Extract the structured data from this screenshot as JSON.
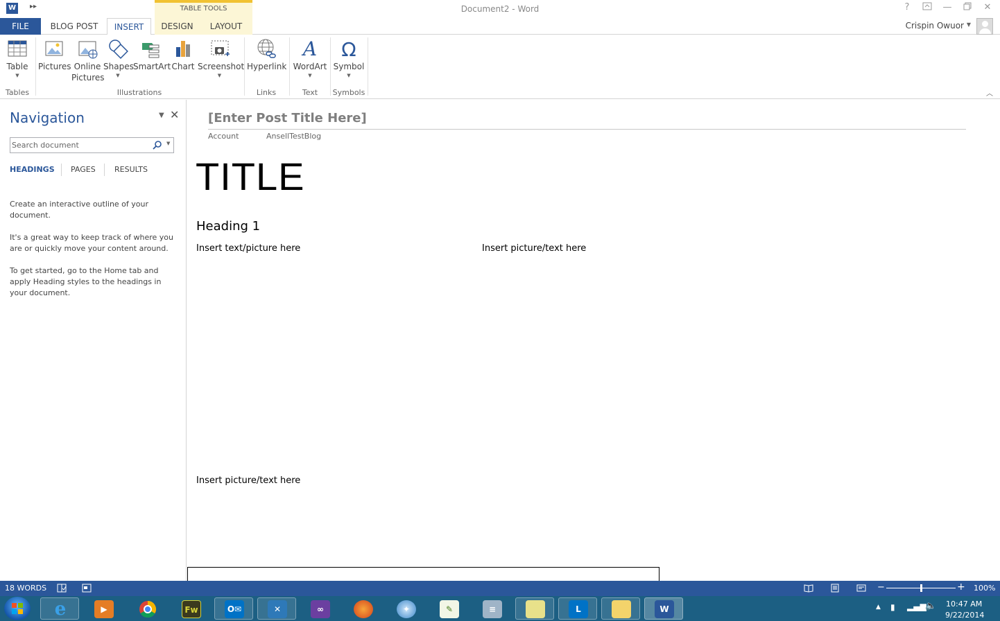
{
  "app": {
    "document_title": "Document2 - Word",
    "contextual_group": "TABLE TOOLS",
    "user_name": "Crispin Owuor"
  },
  "tabs": [
    {
      "label": "FILE"
    },
    {
      "label": "BLOG POST"
    },
    {
      "label": "INSERT"
    },
    {
      "label": "DESIGN"
    },
    {
      "label": "LAYOUT"
    }
  ],
  "ribbon": {
    "buttons": {
      "table": "Table",
      "pictures": "Pictures",
      "online_pictures_1": "Online",
      "online_pictures_2": "Pictures",
      "shapes": "Shapes",
      "smartart": "SmartArt",
      "chart": "Chart",
      "screenshot": "Screenshot",
      "hyperlink": "Hyperlink",
      "wordart": "WordArt",
      "symbol": "Symbol"
    },
    "groups": {
      "tables": "Tables",
      "illustrations": "Illustrations",
      "links": "Links",
      "text": "Text",
      "symbols": "Symbols"
    }
  },
  "navigation": {
    "title": "Navigation",
    "search_placeholder": "Search document",
    "tabs": {
      "headings": "HEADINGS",
      "pages": "PAGES",
      "results": "RESULTS"
    },
    "paragraphs": [
      "Create an interactive outline of your document.",
      "It's a great way to keep track of where you are or quickly move your content around.",
      "To get started, go to the Home tab and apply Heading styles to the headings in your document."
    ]
  },
  "document": {
    "post_title_placeholder": "[Enter Post Title Here]",
    "account_label": "Account",
    "account_value": "AnsellTestBlog",
    "title": "TITLE",
    "heading1": "Heading 1",
    "cell_1": "Insert text/picture here",
    "cell_2": "Insert picture/text here",
    "cell_3": "Insert picture/text here"
  },
  "status": {
    "word_count": "18 WORDS",
    "zoom": "100%",
    "zoom_fraction": 0.5
  },
  "taskbar": {
    "time": "10:47 AM",
    "date": "9/22/2014"
  },
  "colors": {
    "accent": "#2b579a",
    "contextual_tab": "#fcf6d6",
    "taskbar": "#1c5f83"
  }
}
